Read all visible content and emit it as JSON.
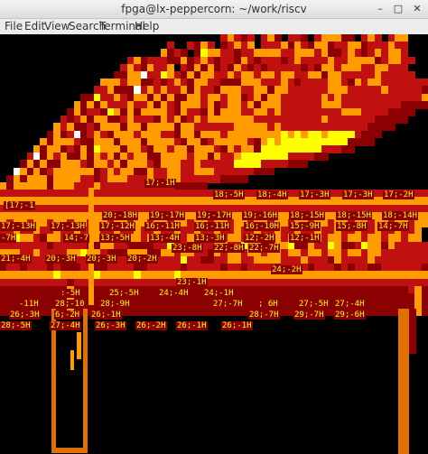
{
  "window": {
    "title": "fpga@lx-peppercorn: ~/work/riscv",
    "controls": {
      "minimize": "–",
      "maximize": "□",
      "close": "✕"
    }
  },
  "menu": [
    "File",
    "Edit",
    "View",
    "Search",
    "Terminal",
    "Help"
  ],
  "palette": {
    "black": "#000000",
    "dark_red": "#8b0000",
    "red": "#c01010",
    "orange": "#ff9c00",
    "amber": "#e07000",
    "yellow": "#ffff00",
    "white": "#ffffff",
    "label_text": "#ffff00",
    "label_bg": "#8b0000"
  },
  "terminal_labels": [
    "17;-1H",
    "18;-5H",
    "18;-4H",
    "17;-3H",
    "17;-3H",
    "17;-2H",
    "[17;-1",
    "20;-18H",
    "19;-17H",
    "19;-17H",
    "19;-16H",
    "18;-15H",
    "18;-15H",
    "18;-14H",
    "17;-13H",
    "17;-13H",
    "17;-12H",
    "16;-11H",
    "16;-11H",
    "16;-10H",
    "15;-9H",
    "15;-8H",
    "14;-7H",
    "-7H",
    "14;-7",
    "13;-5H",
    "13;-4H",
    "13;-3H",
    "12;-2H",
    "12;-1H",
    "23;-8H",
    "22;-8H",
    "22;-7H",
    "21;-4H",
    "20;-3H",
    "20;-3H",
    "20;-2H",
    "24;-2H",
    "23;-1H",
    ":-5H",
    "25;-5H",
    "24;-4H",
    "24;-1H",
    "-11H",
    "28;-10",
    "28;-9H",
    "27;-7H",
    "; 6H",
    "27;-5H",
    "27;-4H",
    "26;-3H",
    "6;-2H",
    "26;-1H",
    "28;-7H",
    "29;-7H",
    "29;-6H",
    "28;-5H",
    "27;-4H",
    "26;-3H",
    "26;-2H",
    "26;-1H",
    "26;-1H"
  ],
  "art_rows": [
    ".................................RORKR.ROK.RRK.ROOOKK.ROR.ROO",
    ".........................R..RKOR.KRORO.RRROKORKOOKRROOKRRRORR",
    "........................OKRK.KYOORRKRROOOORROOOROKKRORKROROOR",
    "...................ROKRRRKKOKRORKRRKORKRRRKRORRRRORROOOOKROORR",
    "..................RORKORRO.RKOKOKRKORKRKRRRRRKRKOOROOORROORRR",
    ".................KKOOWRRYORKOKOORROROOROOROORROOKOORRRRRORRRRR",
    "...............OOOROOKKRKRORKOORRKKKOOORRRORKRRRROORKOROORRRRRRR",
    "..............RROKKKWRORORROKORRKOOORROOKOORRRRRROOORRRRRORRRRRK",
    "............KKYRRORKOOKOKOKKOOROOROOKROKOORRRRRRORORRRRRRRRRRRRO",
    "...........OKOKORRRORROKORKOOOROKROOROKOOORRRRRROOORRRRRRRRRKKKK",
    "..........KOKRRKYOKOKOOOORKORRKOKOOORROORORRRRRRRRROOORRRRKKKK..",
    ".........RKROKOOKKRORRRKOROKROROOOOOOORRRRRRRRRRORRRRRRRKKKKK...",
    "........OROKKRKOOOKOOKOOOOKOORRRRRROOOOORORRRRRRRRRRRRRKKKK.....",
    ".......KOKRWKRORKOOOROOORRKOOKOOOROOOOOOOOYOYOYYOYYYYRKKK.......",
    "......OKOOORKKOOOKOOOKOOOORKOOKROOOOORKOYOYYYYYYYYYYKKKK........",
    ".....OKOOKRKOKYOOOKOORKOOROOKOOORKOROOKYYYYYYYYYRRRKK...........",
    "....RWKOROKKOKOROKOROOKKOOOOROOKORROYYYYYYYRRRRKK...............",
    "...KOKOKKOOORKOOROKOOORKOOORRORRRRRYYYYRRRRKKK..................",
    "..WOKOKROOOOOOKROROOKKORROORROOORRRRRRKKK.......................",
    ".KOKOOOKOOOORRKROOORRRORROORRRRRRKKKK...........................",
    "OKOOOOOKOOORRRORRRRRRRRRRRKKKKK.................................",
    "RRRRRRRRRRRRRRRRRRRRRRRRRRRRRRRRRRRRRRRRRRRRRRRRRRRRRRRRRRRRRRRR",
    "OOOOOOOOOOOOOOOOOOOOOOOOOOOOOOOOOOOOOOOOOOOOOOOOOOOOOOOOOOOOOOOO",
    "RRRRRRRRRRRRRRRRRRRRRRRRRRRRRRRRRRRRRRRRRRRRRRRRRRRRRRRRRRRRRRRR",
    "OOOOOOOOOOOOOOOOOOOOOOOOOOOOOOOOOOOOOOOOOOOOOOOOOOOOOOOOOOOOOOOO",
    "OROOROOROOROOROOROOROOROOROOROOROOROOROOROOROOROOROOROOROOROOROO",
    "RRORRORRORRORRORRORRORRORRORRORRORRORRORRORRORRORRORRORRORRORRO",
    "OOYOORKOOROOYOOROOROOROOROOROOYOOROOROOROOROOROOROOROOROOROOROO",
    "RRRRRRRKRRRRRKKOORRKKKKRRYRRKKRROORRYOOKKOOYKKORRYOKKRYOOKORRRRR",
    "OOORRORRRROOYOORKKKOOOKKOOROORRKOROOROOROOROOROOROOROOROORRRRRRR",
    "ROORRRRROORRRRRKRRRRRRKRRRRYRRKKRROORROOOORRRORRRKORRRRORRRRRRRR",
    "KRRKRRRKRKKKRRKKRRRRKKRRRRRKRRRRRKRRKRRRRKRRRRKRRRKRKRRKKRRRRRRK",
    "OOOOOOOOYOOOOOYOOOOOYOOOOOYOOOOOOOOOOOOOOOOOOOOOOOOOOOOOOOOOOOOO",
    "RRRRRRRRRRKRRRRRRRRRRRRRRRRRRRRRRRRRRRRRRRRRRRRRRRRRRRRRRRRRRRRR",
    "KKKKKKKKKKOKKKKKKKKKKKKKKKKKKKKKKKKKKKKKKKKKKKKKKKKKKKKKKKKKKROK",
    "KKKKKKKKKKOKKKKKKKKKKKKKKKKKKKKKKKKKKKKKKKKKKKKKKKKKKKKKKKKKKKOK",
    "KKKKKKKKKKOKKKKKKKKKKKKKKKKKKKKKKKKKKKKKKKKKKKKKKKKKKKKKKKKKKKOK",
    "KKKKKKKKKKOKKKKKKKKKKKKKKKKKKKKKKKKKKKKKKKKKKKKKKKKKKKKKKKKKKKOK"
  ]
}
